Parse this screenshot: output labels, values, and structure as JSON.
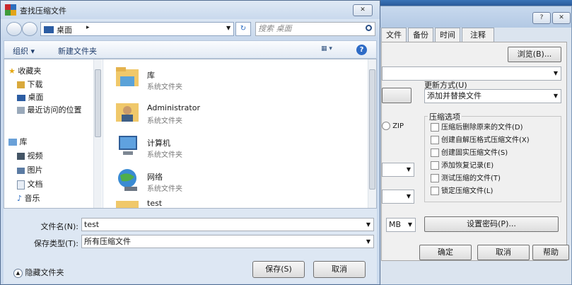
{
  "background_dialog": {
    "tabs": [
      "文件",
      "备份",
      "时间",
      "注释"
    ],
    "browse_button": "浏览(B)...",
    "update_mode_label": "更新方式(U)",
    "update_mode_value": "添加并替换文件",
    "zip_label": "ZIP",
    "size_unit": "MB",
    "compress_options_title": "压缩选项",
    "options": [
      "压缩后删除原来的文件(D)",
      "创建自解压格式压缩文件(X)",
      "创建固实压缩文件(S)",
      "添加恢复记录(E)",
      "测试压缩的文件(T)",
      "锁定压缩文件(L)"
    ],
    "set_password_button": "设置密码(P)...",
    "ok_button": "确定",
    "cancel_button": "取消",
    "help_button": "帮助",
    "title_help_glyph": "?",
    "title_close_glyph": "✕"
  },
  "dialog": {
    "title": "查找压缩文件",
    "close_glyph": "✕",
    "breadcrumb_location": "桌面",
    "breadcrumb_arrow": "▸",
    "search_placeholder": "搜索 桌面",
    "toolbar": {
      "organize": "组织 ▾",
      "new_folder": "新建文件夹"
    },
    "nav": {
      "favorites_head": "收藏夹",
      "favorites": [
        "下载",
        "桌面",
        "最近访问的位置"
      ],
      "libraries_head": "库",
      "libraries": [
        "视频",
        "图片",
        "文档",
        "音乐"
      ]
    },
    "files": [
      {
        "name": "库",
        "type": "系统文件夹",
        "icon": "library-folder-icon"
      },
      {
        "name": "Administrator",
        "type": "系统文件夹",
        "icon": "user-folder-icon"
      },
      {
        "name": "计算机",
        "type": "系统文件夹",
        "icon": "computer-icon"
      },
      {
        "name": "网络",
        "type": "系统文件夹",
        "icon": "network-icon"
      },
      {
        "name": "test",
        "type": "",
        "icon": "folder-icon"
      }
    ],
    "filename_label": "文件名(N):",
    "filename_value": "test",
    "filetype_label": "保存类型(T):",
    "filetype_value": "所有压缩文件",
    "hide_folders": "隐藏文件夹",
    "save_button": "保存(S)",
    "cancel_button": "取消"
  }
}
